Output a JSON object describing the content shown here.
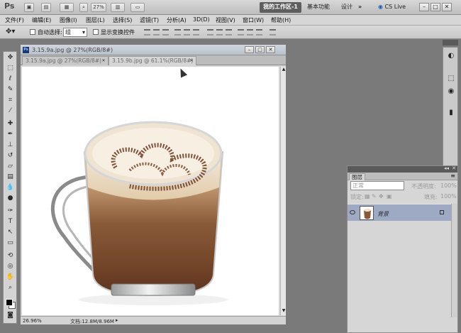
{
  "app": {
    "logo": "Ps"
  },
  "appbar": {
    "zoom": "27%",
    "workspaces": [
      "我的工作区-1",
      "基本功能",
      "设计"
    ],
    "more": "»",
    "cslive": "CS Live"
  },
  "menu": [
    "文件(F)",
    "编辑(E)",
    "图像(I)",
    "图层(L)",
    "选择(S)",
    "滤镜(T)",
    "分析(A)",
    "3D(D)",
    "视图(V)",
    "窗口(W)",
    "帮助(H)"
  ],
  "options": {
    "auto_select_label": "自动选择:",
    "auto_select_value": "组",
    "transform_label": "显示变换控件"
  },
  "document": {
    "window_title": "3.15.9a.jpg @ 27%(RGB/8#)",
    "tabs": [
      {
        "label": "3.15.9a.jpg @ 27%(RGB/8#)",
        "close": "✕"
      },
      {
        "label": "3.15.9b.jpg @ 61.1%(RGB/8#)",
        "close": "✕"
      }
    ],
    "zoom_status": "26.96%",
    "doc_status": "文档:12.8M/8.96M"
  },
  "layers_panel": {
    "tab": "图层",
    "blend_mode": "正常",
    "opacity_label": "不透明度:",
    "opacity_value": "100%",
    "lock_label": "锁定:",
    "fill_label": "填充:",
    "fill_value": "100%",
    "layer_name": "背景"
  },
  "colors": {
    "foreground": "#000000",
    "background": "#ffffff",
    "selected_layer": "#9eaac3"
  }
}
